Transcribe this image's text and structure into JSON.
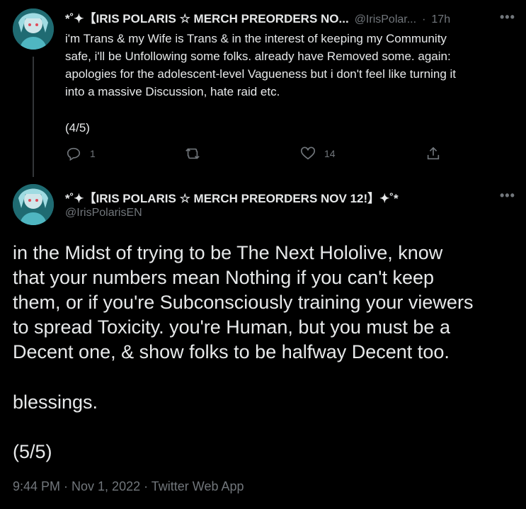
{
  "tweet1": {
    "display_name": "*˚✦【IRIS POLARIS ☆ MERCH PREORDERS NO...",
    "handle": "@IrisPolar...",
    "separator": "·",
    "time": "17h",
    "more": "•••",
    "text_lines": [
      "i'm Trans & my Wife is Trans & in the interest of keeping my Community",
      "safe, i'll be Unfollowing some folks. already have Removed some. again:",
      "apologies for the adolescent-level Vagueness but i don't feel like turning it",
      "into a massive Discussion, hate raid etc."
    ],
    "counter": "(4/5)",
    "replies": "1",
    "likes": "14",
    "icons": {
      "reply": "reply-icon",
      "retweet": "retweet-icon",
      "like": "heart-icon",
      "share": "share-icon"
    }
  },
  "tweet2": {
    "display_name": "*˚✦【IRIS POLARIS ☆ MERCH PREORDERS NOV 12!】✦˚*",
    "handle": "@IrisPolarisEN",
    "more": "•••",
    "text_lines": [
      "in the Midst of trying to be The Next Hololive, know",
      "that your numbers mean Nothing if you can't keep",
      "them, or if you're Subconsciously training your viewers",
      "to spread Toxicity. you're Human, but you must be a",
      "Decent one, & show folks to be halfway Decent too."
    ],
    "blessing": "blessings.",
    "counter": "(5/5)",
    "meta": "9:44 PM · Nov 1, 2022 · Twitter Web App"
  },
  "colors": {
    "background": "#000000",
    "text": "#e7e9ea",
    "muted": "#71767b",
    "line": "#333639"
  }
}
